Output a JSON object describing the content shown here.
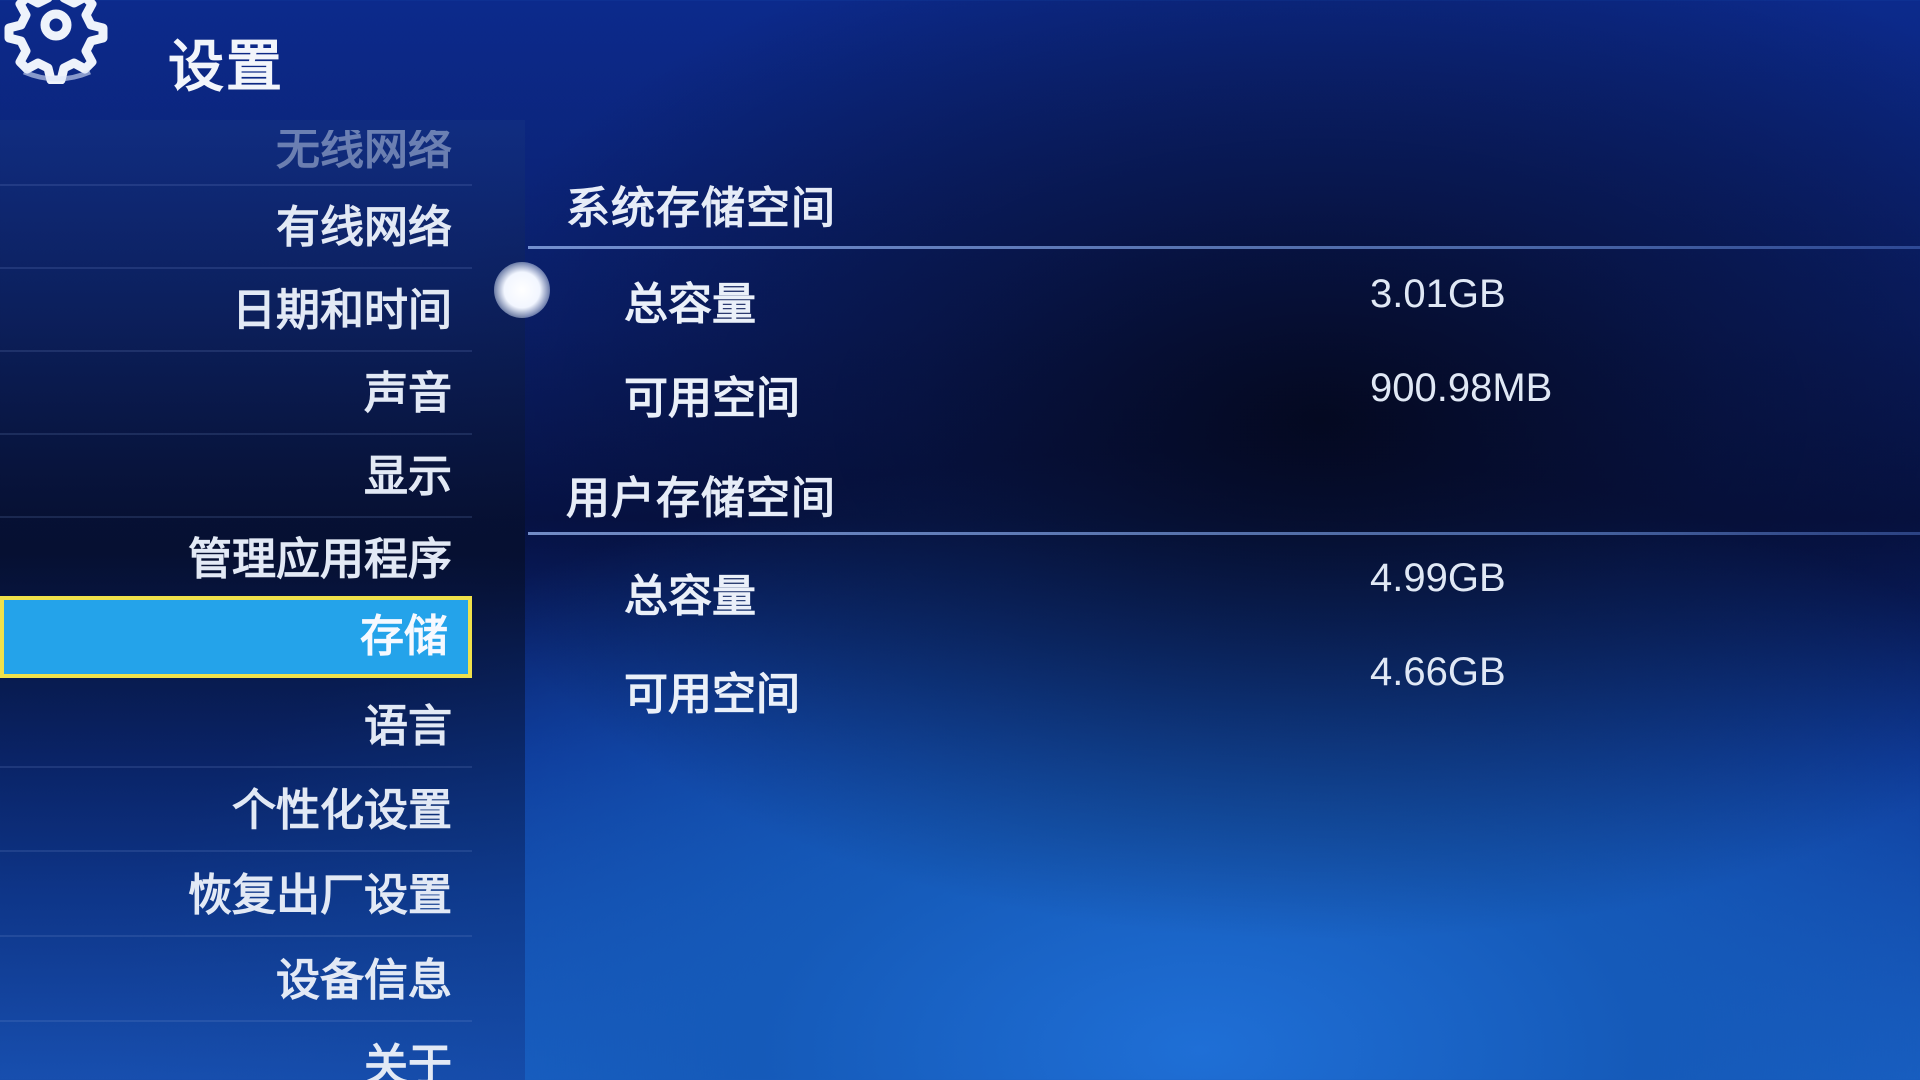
{
  "header": {
    "title": "设置",
    "icon": "gear-icon"
  },
  "sidebar": {
    "items": [
      {
        "label": "无线网络",
        "state": "partially-visible"
      },
      {
        "label": "有线网络"
      },
      {
        "label": "日期和时间"
      },
      {
        "label": "声音"
      },
      {
        "label": "显示"
      },
      {
        "label": "管理应用程序"
      },
      {
        "label": "存储",
        "state": "selected"
      },
      {
        "label": "语言"
      },
      {
        "label": "个性化设置"
      },
      {
        "label": "恢复出厂设置"
      },
      {
        "label": "设备信息"
      },
      {
        "label": "关于",
        "state": "partially-visible"
      }
    ],
    "active_color": "#24a3ea",
    "focus_border_color": "#f0e14a"
  },
  "storage": {
    "system": {
      "title": "系统存储空间",
      "total_label": "总容量",
      "total_value": "3.01GB",
      "free_label": "可用空间",
      "free_value": "900.98MB"
    },
    "user": {
      "title": "用户存储空间",
      "total_label": "总容量",
      "total_value": "4.99GB",
      "free_label": "可用空间",
      "free_value": "4.66GB"
    }
  }
}
